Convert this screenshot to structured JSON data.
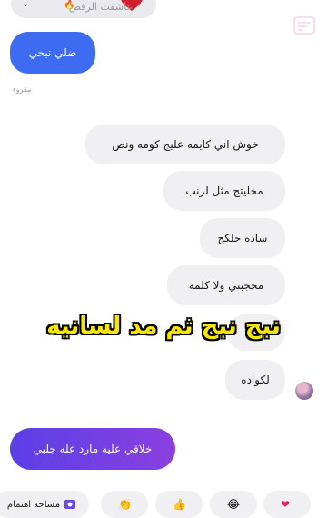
{
  "top_card": {
    "label": "عاشقت الرقص"
  },
  "messages": {
    "sent_1": "ضلي نبحي",
    "read_status": "مقروء",
    "recv": [
      "خوش اني كايمه عليج كومه ونص",
      "مخليتج مثل لرنب",
      "ساده حلكج",
      "محجبتي ولا كلمه",
      "لكواده"
    ]
  },
  "overlay": {
    "caption": "نبح نبح ثم مد لسانيه"
  },
  "composer": {
    "suggestion": "خلاقي عليه مارد عله جلبي"
  },
  "quick_actions": {
    "interest_label": "مساحة اهتمام"
  },
  "colors": {
    "sent_bubble": "#3d6cf2",
    "recv_bubble": "#f0f0f3",
    "caption_text": "#f7e600"
  }
}
